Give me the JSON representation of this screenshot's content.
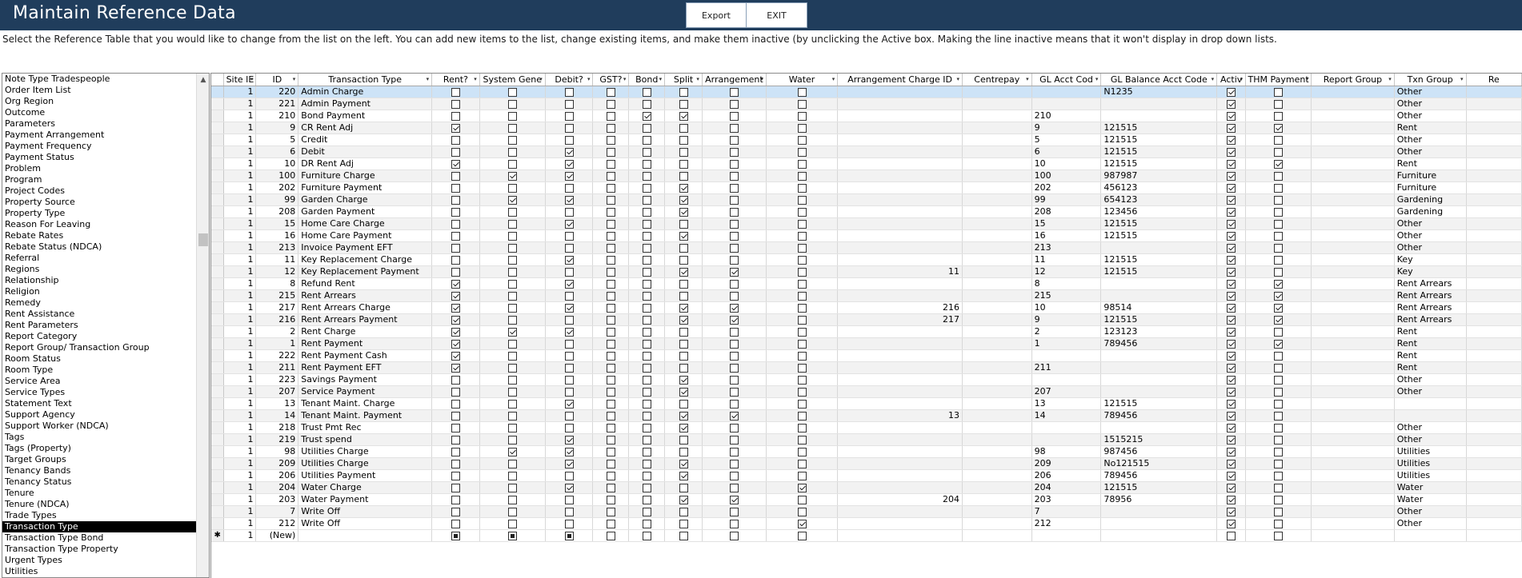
{
  "window": {
    "title": "Maintain Reference Data"
  },
  "toolbar": {
    "export_label": "Export",
    "exit_label": "EXIT"
  },
  "instructions": "Select the Reference Table that you would like to change from the list on the left. You can add new items to the list, change existing items, and make them inactive (by unclicking the Active box. Making the line inactive means that it won't display in drop down lists.",
  "left_list": {
    "selected": "Transaction Type",
    "items": [
      "Note Type Tradespeople",
      "Order Item List",
      "Org Region",
      "Outcome",
      "Parameters",
      "Payment Arrangement",
      "Payment Frequency",
      "Payment Status",
      "Problem",
      "Program",
      "Project Codes",
      "Property Source",
      "Property Type",
      "Reason For Leaving",
      "Rebate Rates",
      "Rebate Status (NDCA)",
      "Referral",
      "Regions",
      "Relationship",
      "Religion",
      "Remedy",
      "Rent Assistance",
      "Rent Parameters",
      "Report Category",
      "Report Group/ Transaction Group",
      "Room Status",
      "Room Type",
      "Service Area",
      "Service Types",
      "Statement Text",
      "Support Agency",
      "Support Worker (NDCA)",
      "Tags",
      "Tags (Property)",
      "Target Groups",
      "Tenancy Bands",
      "Tenancy Status",
      "Tenure",
      "Tenure (NDCA)",
      "Trade Types",
      "Transaction Type",
      "Transaction Type Bond",
      "Transaction Type Property",
      "Urgent Types",
      "Utilities"
    ]
  },
  "grid": {
    "columns": [
      "Site IE",
      "ID",
      "Transaction Type",
      "Rent?",
      "System Gene",
      "Debit?",
      "GST?",
      "Bond",
      "Split",
      "Arrangement",
      "Water",
      "Arrangement Charge ID",
      "Centrepay",
      "GL Acct Cod",
      "GL Balance Acct Code",
      "Activ",
      "THM Payment",
      "Report Group",
      "Txn Group",
      "Re"
    ],
    "rows": [
      {
        "site": "1",
        "id": "220",
        "type": "Admin Charge",
        "rent": 0,
        "sys": 0,
        "debit": 0,
        "gst": 0,
        "bond": 0,
        "split": 0,
        "arr": 0,
        "water": 0,
        "arr_id": "",
        "centrepay": "",
        "gl": "",
        "glbal": "N1235",
        "active": 1,
        "thm": 0,
        "rg": "",
        "txn": "Other"
      },
      {
        "site": "1",
        "id": "221",
        "type": "Admin Payment",
        "rent": 0,
        "sys": 0,
        "debit": 0,
        "gst": 0,
        "bond": 0,
        "split": 0,
        "arr": 0,
        "water": 0,
        "arr_id": "",
        "centrepay": "",
        "gl": "",
        "glbal": "",
        "active": 1,
        "thm": 0,
        "rg": "",
        "txn": "Other"
      },
      {
        "site": "1",
        "id": "210",
        "type": "Bond Payment",
        "rent": 0,
        "sys": 0,
        "debit": 0,
        "gst": 0,
        "bond": 1,
        "split": 1,
        "arr": 0,
        "water": 0,
        "arr_id": "",
        "centrepay": "",
        "gl": "210",
        "glbal": "",
        "active": 1,
        "thm": 0,
        "rg": "",
        "txn": "Other"
      },
      {
        "site": "1",
        "id": "9",
        "type": "CR Rent Adj",
        "rent": 1,
        "sys": 0,
        "debit": 0,
        "gst": 0,
        "bond": 0,
        "split": 0,
        "arr": 0,
        "water": 0,
        "arr_id": "",
        "centrepay": "",
        "gl": "9",
        "glbal": "121515",
        "active": 1,
        "thm": 1,
        "rg": "",
        "txn": "Rent"
      },
      {
        "site": "1",
        "id": "5",
        "type": "Credit",
        "rent": 0,
        "sys": 0,
        "debit": 0,
        "gst": 0,
        "bond": 0,
        "split": 0,
        "arr": 0,
        "water": 0,
        "arr_id": "",
        "centrepay": "",
        "gl": "5",
        "glbal": "121515",
        "active": 1,
        "thm": 0,
        "rg": "",
        "txn": "Other"
      },
      {
        "site": "1",
        "id": "6",
        "type": "Debit",
        "rent": 0,
        "sys": 0,
        "debit": 1,
        "gst": 0,
        "bond": 0,
        "split": 0,
        "arr": 0,
        "water": 0,
        "arr_id": "",
        "centrepay": "",
        "gl": "6",
        "glbal": "121515",
        "active": 1,
        "thm": 0,
        "rg": "",
        "txn": "Other"
      },
      {
        "site": "1",
        "id": "10",
        "type": "DR Rent Adj",
        "rent": 1,
        "sys": 0,
        "debit": 1,
        "gst": 0,
        "bond": 0,
        "split": 0,
        "arr": 0,
        "water": 0,
        "arr_id": "",
        "centrepay": "",
        "gl": "10",
        "glbal": "121515",
        "active": 1,
        "thm": 1,
        "rg": "",
        "txn": "Rent"
      },
      {
        "site": "1",
        "id": "100",
        "type": "Furniture Charge",
        "rent": 0,
        "sys": 1,
        "debit": 1,
        "gst": 0,
        "bond": 0,
        "split": 0,
        "arr": 0,
        "water": 0,
        "arr_id": "",
        "centrepay": "",
        "gl": "100",
        "glbal": "987987",
        "active": 1,
        "thm": 0,
        "rg": "",
        "txn": "Furniture"
      },
      {
        "site": "1",
        "id": "202",
        "type": "Furniture Payment",
        "rent": 0,
        "sys": 0,
        "debit": 0,
        "gst": 0,
        "bond": 0,
        "split": 1,
        "arr": 0,
        "water": 0,
        "arr_id": "",
        "centrepay": "",
        "gl": "202",
        "glbal": "456123",
        "active": 1,
        "thm": 0,
        "rg": "",
        "txn": "Furniture"
      },
      {
        "site": "1",
        "id": "99",
        "type": "Garden Charge",
        "rent": 0,
        "sys": 1,
        "debit": 1,
        "gst": 0,
        "bond": 0,
        "split": 1,
        "arr": 0,
        "water": 0,
        "arr_id": "",
        "centrepay": "",
        "gl": "99",
        "glbal": "654123",
        "active": 1,
        "thm": 0,
        "rg": "",
        "txn": "Gardening"
      },
      {
        "site": "1",
        "id": "208",
        "type": "Garden Payment",
        "rent": 0,
        "sys": 0,
        "debit": 0,
        "gst": 0,
        "bond": 0,
        "split": 1,
        "arr": 0,
        "water": 0,
        "arr_id": "",
        "centrepay": "",
        "gl": "208",
        "glbal": "123456",
        "active": 1,
        "thm": 0,
        "rg": "",
        "txn": "Gardening"
      },
      {
        "site": "1",
        "id": "15",
        "type": "Home Care Charge",
        "rent": 0,
        "sys": 0,
        "debit": 1,
        "gst": 0,
        "bond": 0,
        "split": 0,
        "arr": 0,
        "water": 0,
        "arr_id": "",
        "centrepay": "",
        "gl": "15",
        "glbal": "121515",
        "active": 1,
        "thm": 0,
        "rg": "",
        "txn": "Other"
      },
      {
        "site": "1",
        "id": "16",
        "type": "Home Care Payment",
        "rent": 0,
        "sys": 0,
        "debit": 0,
        "gst": 0,
        "bond": 0,
        "split": 1,
        "arr": 0,
        "water": 0,
        "arr_id": "",
        "centrepay": "",
        "gl": "16",
        "glbal": "121515",
        "active": 1,
        "thm": 0,
        "rg": "",
        "txn": "Other"
      },
      {
        "site": "1",
        "id": "213",
        "type": "Invoice Payment EFT",
        "rent": 0,
        "sys": 0,
        "debit": 0,
        "gst": 0,
        "bond": 0,
        "split": 0,
        "arr": 0,
        "water": 0,
        "arr_id": "",
        "centrepay": "",
        "gl": "213",
        "glbal": "",
        "active": 1,
        "thm": 0,
        "rg": "",
        "txn": "Other"
      },
      {
        "site": "1",
        "id": "11",
        "type": "Key Replacement Charge",
        "rent": 0,
        "sys": 0,
        "debit": 1,
        "gst": 0,
        "bond": 0,
        "split": 0,
        "arr": 0,
        "water": 0,
        "arr_id": "",
        "centrepay": "",
        "gl": "11",
        "glbal": "121515",
        "active": 1,
        "thm": 0,
        "rg": "",
        "txn": "Key"
      },
      {
        "site": "1",
        "id": "12",
        "type": "Key Replacement Payment",
        "rent": 0,
        "sys": 0,
        "debit": 0,
        "gst": 0,
        "bond": 0,
        "split": 1,
        "arr": 1,
        "water": 0,
        "arr_id": "11",
        "centrepay": "",
        "gl": "12",
        "glbal": "121515",
        "active": 1,
        "thm": 0,
        "rg": "",
        "txn": "Key"
      },
      {
        "site": "1",
        "id": "8",
        "type": "Refund Rent",
        "rent": 1,
        "sys": 0,
        "debit": 1,
        "gst": 0,
        "bond": 0,
        "split": 0,
        "arr": 0,
        "water": 0,
        "arr_id": "",
        "centrepay": "",
        "gl": "8",
        "glbal": "",
        "active": 1,
        "thm": 1,
        "rg": "",
        "txn": "Rent Arrears"
      },
      {
        "site": "1",
        "id": "215",
        "type": "Rent Arrears",
        "rent": 1,
        "sys": 0,
        "debit": 0,
        "gst": 0,
        "bond": 0,
        "split": 0,
        "arr": 0,
        "water": 0,
        "arr_id": "",
        "centrepay": "",
        "gl": "215",
        "glbal": "",
        "active": 1,
        "thm": 1,
        "rg": "",
        "txn": "Rent Arrears"
      },
      {
        "site": "1",
        "id": "217",
        "type": "Rent Arrears Charge",
        "rent": 1,
        "sys": 0,
        "debit": 1,
        "gst": 0,
        "bond": 0,
        "split": 1,
        "arr": 1,
        "water": 0,
        "arr_id": "216",
        "centrepay": "",
        "gl": "10",
        "glbal": "98514",
        "active": 1,
        "thm": 1,
        "rg": "",
        "txn": "Rent Arrears"
      },
      {
        "site": "1",
        "id": "216",
        "type": "Rent Arrears Payment",
        "rent": 1,
        "sys": 0,
        "debit": 0,
        "gst": 0,
        "bond": 0,
        "split": 1,
        "arr": 1,
        "water": 0,
        "arr_id": "217",
        "centrepay": "",
        "gl": "9",
        "glbal": "121515",
        "active": 1,
        "thm": 1,
        "rg": "",
        "txn": "Rent Arrears"
      },
      {
        "site": "1",
        "id": "2",
        "type": "Rent Charge",
        "rent": 1,
        "sys": 1,
        "debit": 1,
        "gst": 0,
        "bond": 0,
        "split": 0,
        "arr": 0,
        "water": 0,
        "arr_id": "",
        "centrepay": "",
        "gl": "2",
        "glbal": "123123",
        "active": 1,
        "thm": 0,
        "rg": "",
        "txn": "Rent"
      },
      {
        "site": "1",
        "id": "1",
        "type": "Rent Payment",
        "rent": 1,
        "sys": 0,
        "debit": 0,
        "gst": 0,
        "bond": 0,
        "split": 0,
        "arr": 0,
        "water": 0,
        "arr_id": "",
        "centrepay": "",
        "gl": "1",
        "glbal": "789456",
        "active": 1,
        "thm": 1,
        "rg": "",
        "txn": "Rent"
      },
      {
        "site": "1",
        "id": "222",
        "type": "Rent Payment Cash",
        "rent": 1,
        "sys": 0,
        "debit": 0,
        "gst": 0,
        "bond": 0,
        "split": 0,
        "arr": 0,
        "water": 0,
        "arr_id": "",
        "centrepay": "",
        "gl": "",
        "glbal": "",
        "active": 1,
        "thm": 0,
        "rg": "",
        "txn": "Rent"
      },
      {
        "site": "1",
        "id": "211",
        "type": "Rent Payment EFT",
        "rent": 1,
        "sys": 0,
        "debit": 0,
        "gst": 0,
        "bond": 0,
        "split": 0,
        "arr": 0,
        "water": 0,
        "arr_id": "",
        "centrepay": "",
        "gl": "211",
        "glbal": "",
        "active": 1,
        "thm": 0,
        "rg": "",
        "txn": "Rent"
      },
      {
        "site": "1",
        "id": "223",
        "type": "Savings Payment",
        "rent": 0,
        "sys": 0,
        "debit": 0,
        "gst": 0,
        "bond": 0,
        "split": 1,
        "arr": 0,
        "water": 0,
        "arr_id": "",
        "centrepay": "",
        "gl": "",
        "glbal": "",
        "active": 1,
        "thm": 0,
        "rg": "",
        "txn": "Other"
      },
      {
        "site": "1",
        "id": "207",
        "type": "Service Payment",
        "rent": 0,
        "sys": 0,
        "debit": 0,
        "gst": 0,
        "bond": 0,
        "split": 1,
        "arr": 0,
        "water": 0,
        "arr_id": "",
        "centrepay": "",
        "gl": "207",
        "glbal": "",
        "active": 1,
        "thm": 0,
        "rg": "",
        "txn": "Other"
      },
      {
        "site": "1",
        "id": "13",
        "type": "Tenant Maint. Charge",
        "rent": 0,
        "sys": 0,
        "debit": 1,
        "gst": 0,
        "bond": 0,
        "split": 0,
        "arr": 0,
        "water": 0,
        "arr_id": "",
        "centrepay": "",
        "gl": "13",
        "glbal": "121515",
        "active": 1,
        "thm": 0,
        "rg": "",
        "txn": ""
      },
      {
        "site": "1",
        "id": "14",
        "type": "Tenant Maint. Payment",
        "rent": 0,
        "sys": 0,
        "debit": 0,
        "gst": 0,
        "bond": 0,
        "split": 1,
        "arr": 1,
        "water": 0,
        "arr_id": "13",
        "centrepay": "",
        "gl": "14",
        "glbal": "789456",
        "active": 1,
        "thm": 0,
        "rg": "",
        "txn": ""
      },
      {
        "site": "1",
        "id": "218",
        "type": "Trust Pmt Rec",
        "rent": 0,
        "sys": 0,
        "debit": 0,
        "gst": 0,
        "bond": 0,
        "split": 1,
        "arr": 0,
        "water": 0,
        "arr_id": "",
        "centrepay": "",
        "gl": "",
        "glbal": "",
        "active": 1,
        "thm": 0,
        "rg": "",
        "txn": "Other"
      },
      {
        "site": "1",
        "id": "219",
        "type": "Trust spend",
        "rent": 0,
        "sys": 0,
        "debit": 1,
        "gst": 0,
        "bond": 0,
        "split": 0,
        "arr": 0,
        "water": 0,
        "arr_id": "",
        "centrepay": "",
        "gl": "",
        "glbal": "1515215",
        "active": 1,
        "thm": 0,
        "rg": "",
        "txn": "Other"
      },
      {
        "site": "1",
        "id": "98",
        "type": "Utilities Charge",
        "rent": 0,
        "sys": 1,
        "debit": 1,
        "gst": 0,
        "bond": 0,
        "split": 0,
        "arr": 0,
        "water": 0,
        "arr_id": "",
        "centrepay": "",
        "gl": "98",
        "glbal": "987456",
        "active": 1,
        "thm": 0,
        "rg": "",
        "txn": "Utilities"
      },
      {
        "site": "1",
        "id": "209",
        "type": "Utilities Charge",
        "rent": 0,
        "sys": 0,
        "debit": 1,
        "gst": 0,
        "bond": 0,
        "split": 1,
        "arr": 0,
        "water": 0,
        "arr_id": "",
        "centrepay": "",
        "gl": "209",
        "glbal": "No121515",
        "active": 1,
        "thm": 0,
        "rg": "",
        "txn": "Utilities"
      },
      {
        "site": "1",
        "id": "206",
        "type": "Utilities Payment",
        "rent": 0,
        "sys": 0,
        "debit": 0,
        "gst": 0,
        "bond": 0,
        "split": 1,
        "arr": 0,
        "water": 0,
        "arr_id": "",
        "centrepay": "",
        "gl": "206",
        "glbal": "789456",
        "active": 1,
        "thm": 0,
        "rg": "",
        "txn": "Utilities"
      },
      {
        "site": "1",
        "id": "204",
        "type": "Water Charge",
        "rent": 0,
        "sys": 0,
        "debit": 1,
        "gst": 0,
        "bond": 0,
        "split": 0,
        "arr": 0,
        "water": 1,
        "arr_id": "",
        "centrepay": "",
        "gl": "204",
        "glbal": "121515",
        "active": 1,
        "thm": 0,
        "rg": "",
        "txn": "Water"
      },
      {
        "site": "1",
        "id": "203",
        "type": "Water Payment",
        "rent": 0,
        "sys": 0,
        "debit": 0,
        "gst": 0,
        "bond": 0,
        "split": 1,
        "arr": 1,
        "water": 0,
        "arr_id": "204",
        "centrepay": "",
        "gl": "203",
        "glbal": "78956",
        "active": 1,
        "thm": 0,
        "rg": "",
        "txn": "Water"
      },
      {
        "site": "1",
        "id": "7",
        "type": "Write Off",
        "rent": 0,
        "sys": 0,
        "debit": 0,
        "gst": 0,
        "bond": 0,
        "split": 0,
        "arr": 0,
        "water": 0,
        "arr_id": "",
        "centrepay": "",
        "gl": "7",
        "glbal": "",
        "active": 1,
        "thm": 0,
        "rg": "",
        "txn": "Other"
      },
      {
        "site": "1",
        "id": "212",
        "type": "Write Off",
        "rent": 0,
        "sys": 0,
        "debit": 0,
        "gst": 0,
        "bond": 0,
        "split": 0,
        "arr": 0,
        "water": 1,
        "arr_id": "",
        "centrepay": "",
        "gl": "212",
        "glbal": "",
        "active": 1,
        "thm": 0,
        "rg": "",
        "txn": "Other"
      }
    ],
    "new_row": {
      "marker": "✱",
      "site": "1",
      "id": "(New)"
    }
  }
}
